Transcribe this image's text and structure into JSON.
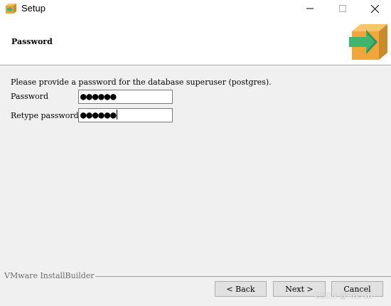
{
  "window": {
    "title": "Setup",
    "icons": [
      "app-icon",
      "minimize-icon",
      "maximize-icon",
      "close-icon",
      "installer-box-icon"
    ]
  },
  "header": {
    "title": "Password"
  },
  "form": {
    "description": "Please provide a password for the database superuser (postgres).",
    "password_label": "Password",
    "password_value": "●●●●●●",
    "retype_label": "Retype password",
    "retype_value": "●●●●●●"
  },
  "footer": {
    "brand": "VMware InstallBuilder",
    "back_label": "< Back",
    "next_label": "Next >",
    "cancel_label": "Cancel"
  },
  "watermark": "CSDN @Roc-xb",
  "colors": {
    "window_bg": "#ffffff",
    "content_bg": "#f0f0f0",
    "button_bg": "#e1e1e1",
    "icon_orange": "#f5a623",
    "icon_green": "#3cb371"
  }
}
